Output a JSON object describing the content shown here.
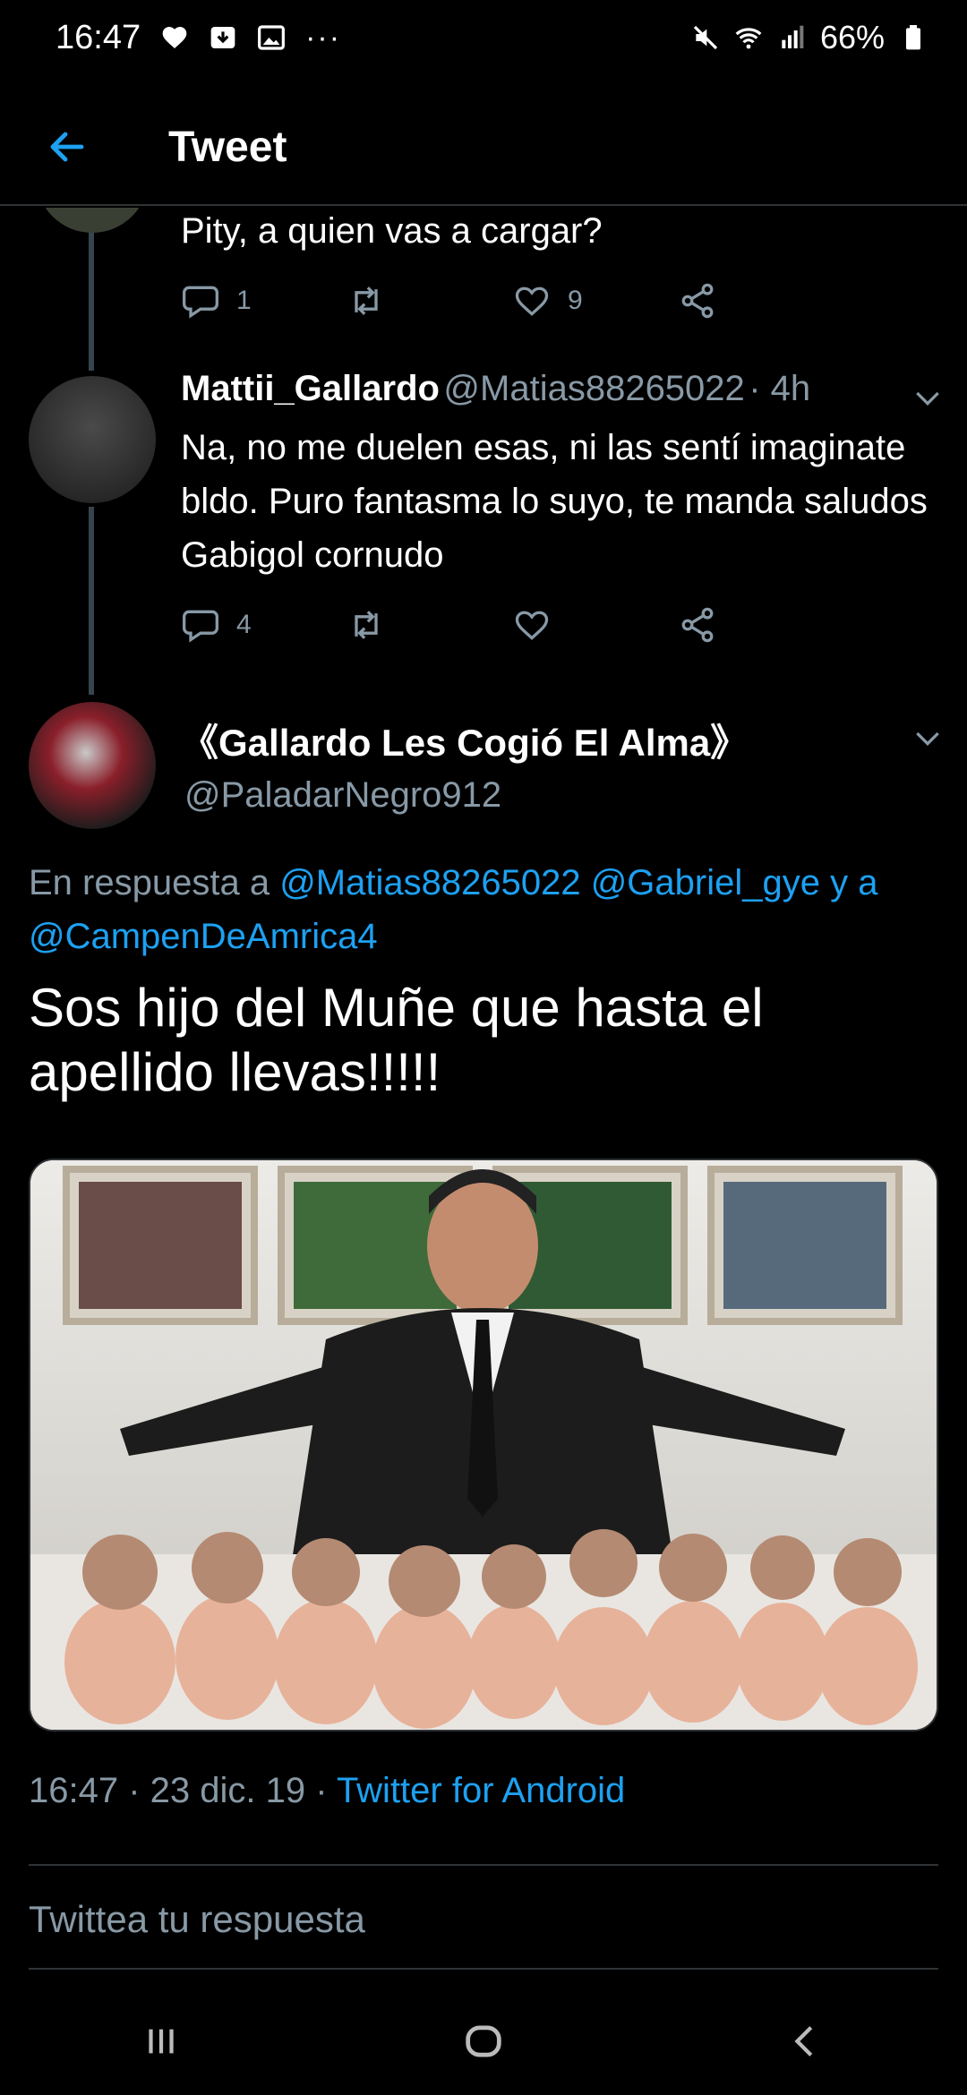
{
  "status_bar": {
    "time": "16:47",
    "battery": "66%",
    "icons": [
      "heart-icon",
      "download-icon",
      "image-icon",
      "more-icon",
      "mute-icon",
      "wifi-icon",
      "signal-icon",
      "battery-icon"
    ]
  },
  "app_bar": {
    "title": "Tweet",
    "back_icon": "arrow-left-icon"
  },
  "reply_prev": {
    "text": "Pity, a quien vas a cargar?",
    "replies": "1",
    "retweets": "",
    "likes": "9"
  },
  "reply_mattii": {
    "name": "Mattii_Gallardo",
    "handle": "@Matias88265022",
    "time": "· 4h",
    "text": "Na, no me duelen esas, ni las sentí imaginate bldo. Puro fantasma lo suyo, te manda saludos Gabigol cornudo",
    "replies": "4",
    "retweets": "",
    "likes": ""
  },
  "main_tweet": {
    "name": "《Gallardo Les Cogió El Alma》",
    "handle": "@PaladarNegro912",
    "in_reply_prefix": "En respuesta a",
    "mention_1": "@Matias88265022",
    "mention_2": "@Gabriel_gye",
    "connector": "y a",
    "mention_3": "@CampenDeAmrica4",
    "text": "Sos hijo del Muñe que hasta el apellido llevas!!!!!",
    "timestamp": "16:47 · 23 dic. 19 ·",
    "source": "Twitter for Android"
  },
  "compose": {
    "placeholder": "Twittea tu respuesta"
  },
  "colors": {
    "accent": "#1da1f2",
    "muted": "#8899a6",
    "divider": "#2f3336"
  }
}
